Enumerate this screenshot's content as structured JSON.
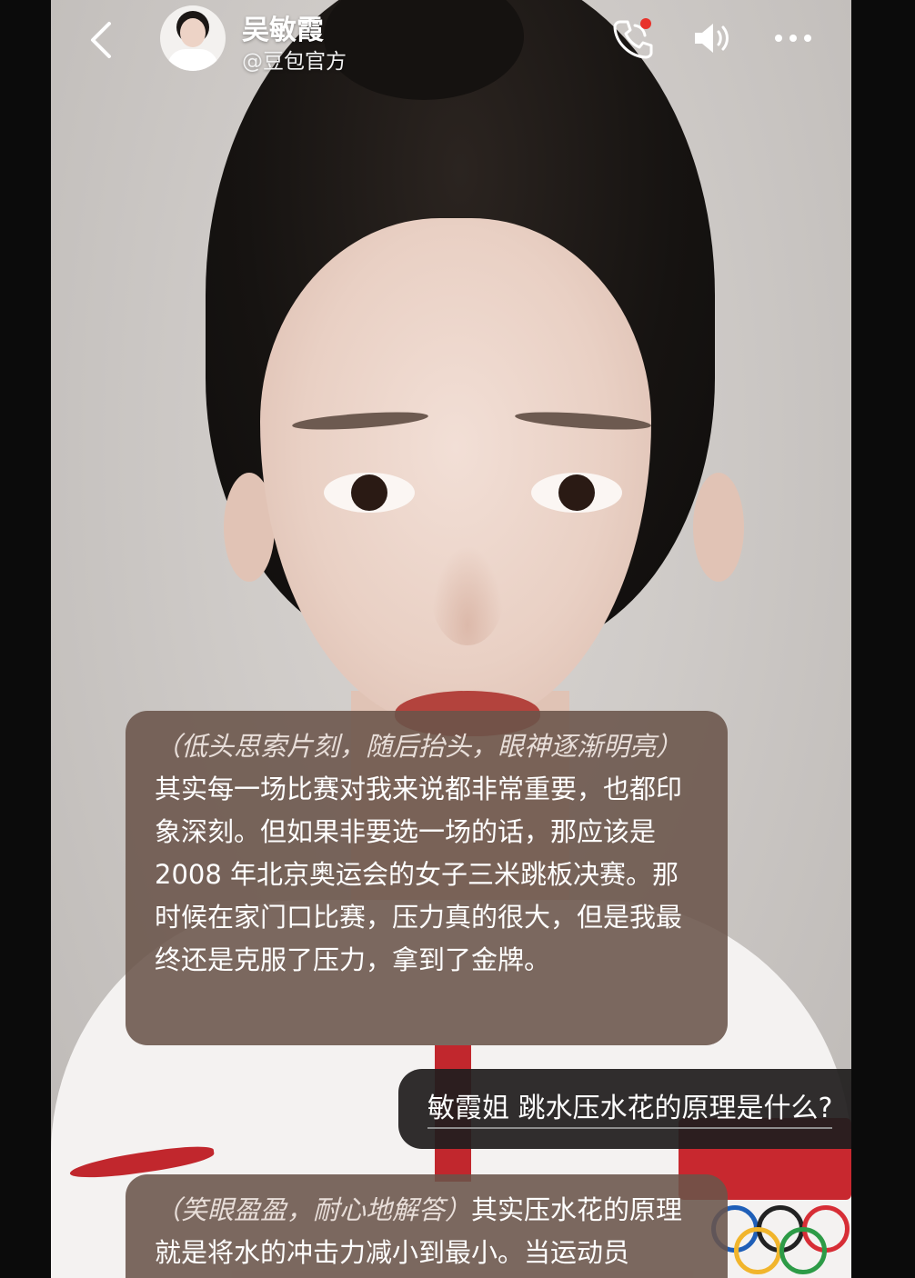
{
  "header": {
    "contact_name": "吴敏霞",
    "contact_handle": "@豆包官方",
    "icons": [
      "back-icon",
      "phone-call-icon",
      "speaker-icon",
      "more-icon"
    ],
    "notification_color": "#e8322b"
  },
  "messages": [
    {
      "role": "assistant",
      "action": "（低头思索片刻，随后抬头，眼神逐渐明亮）",
      "text": "其实每一场比赛对我来说都非常重要，也都印象深刻。但如果非要选一场的话，那应该是 2008 年北京奥运会的女子三米跳板决赛。那时候在家门口比赛，压力真的很大，但是我最终还是克服了压力，拿到了金牌。"
    },
    {
      "role": "user",
      "text": "敏霞姐 跳水压水花的原理是什么?"
    },
    {
      "role": "assistant",
      "action": "（笑眼盈盈，耐心地解答）",
      "text": "其实压水花的原理就是将水的冲击力减小到最小。当运动员"
    }
  ],
  "colors": {
    "assistant_bubble": "#6a544a",
    "user_bubble": "#201e1e"
  }
}
